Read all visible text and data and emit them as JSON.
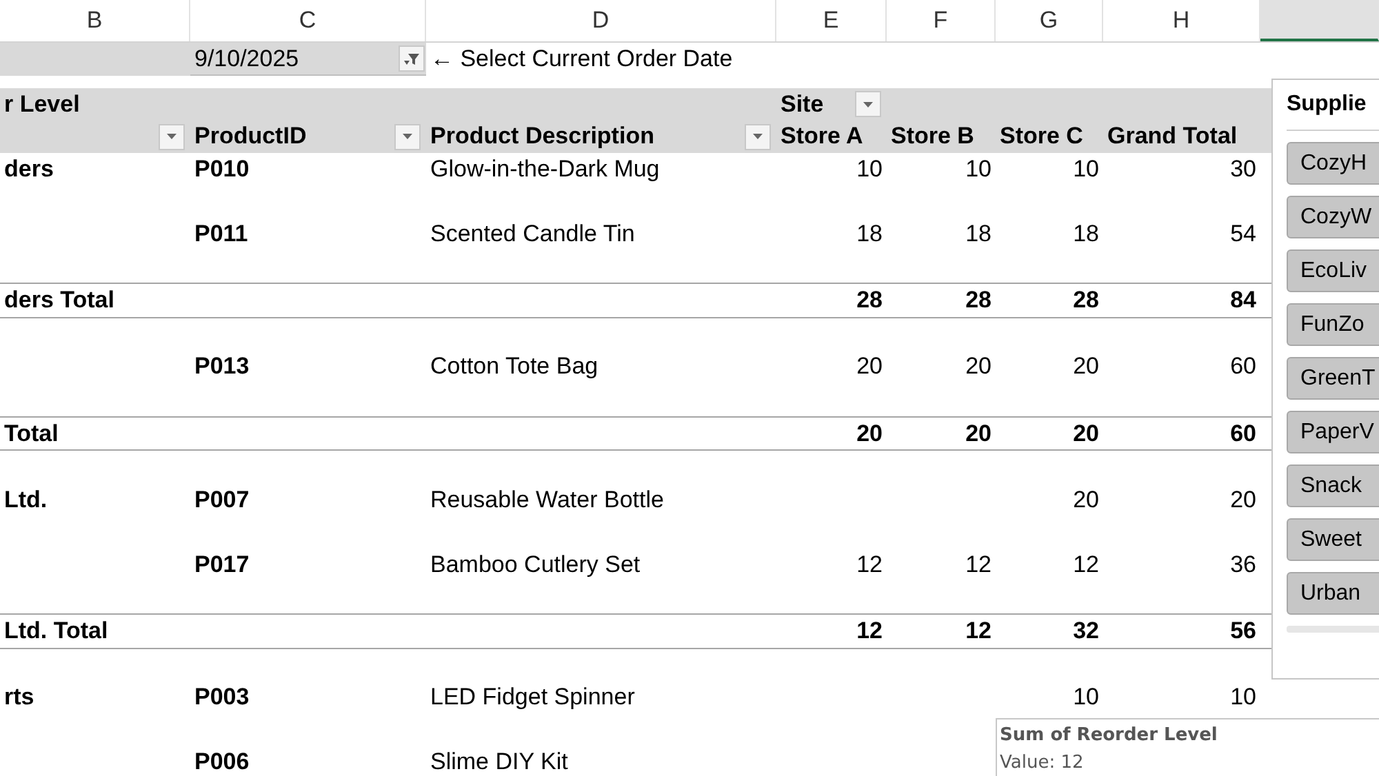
{
  "column_headers": [
    {
      "label": "B",
      "selected": false
    },
    {
      "label": "C",
      "selected": false
    },
    {
      "label": "D",
      "selected": false
    },
    {
      "label": "E",
      "selected": false
    },
    {
      "label": "F",
      "selected": false
    },
    {
      "label": "G",
      "selected": false
    },
    {
      "label": "H",
      "selected": false
    },
    {
      "selected": true
    }
  ],
  "report_filter": {
    "value": "9/10/2025",
    "note": "← Select Current Order Date"
  },
  "pivot": {
    "row_label": "r Level",
    "column_field": "Site",
    "headers": [
      "ProductID",
      "Product Description",
      "Store A",
      "Store B",
      "Store C",
      "Grand Total"
    ],
    "rows": [
      {
        "kind": "item",
        "supplier": "ders",
        "product_id": "P010",
        "description": "Glow-in-the-Dark Mug",
        "values": {
          "store_a": "10",
          "store_b": "10",
          "store_c": "10",
          "grand_total": "30"
        }
      },
      {
        "kind": "item",
        "product_id": "P011",
        "description": "Scented Candle Tin",
        "values": {
          "store_a": "18",
          "store_b": "18",
          "store_c": "18",
          "grand_total": "54"
        }
      },
      {
        "kind": "total",
        "label": "ders Total",
        "values": {
          "store_a": "28",
          "store_b": "28",
          "store_c": "28",
          "grand_total": "84"
        }
      },
      {
        "kind": "item",
        "product_id": "P013",
        "description": "Cotton Tote Bag",
        "values": {
          "store_a": "20",
          "store_b": "20",
          "store_c": "20",
          "grand_total": "60"
        }
      },
      {
        "kind": "total",
        "label": "Total",
        "values": {
          "store_a": "20",
          "store_b": "20",
          "store_c": "20",
          "grand_total": "60"
        }
      },
      {
        "kind": "item",
        "supplier": "Ltd.",
        "product_id": "P007",
        "description": "Reusable Water Bottle",
        "values": {
          "store_c": "20",
          "grand_total": "20"
        }
      },
      {
        "kind": "item",
        "product_id": "P017",
        "description": "Bamboo Cutlery Set",
        "values": {
          "store_a": "12",
          "store_b": "12",
          "store_c": "12",
          "grand_total": "36"
        }
      },
      {
        "kind": "total",
        "label": "Ltd. Total",
        "values": {
          "store_a": "12",
          "store_b": "12",
          "store_c": "32",
          "grand_total": "56"
        }
      },
      {
        "kind": "item",
        "supplier": "rts",
        "product_id": "P003",
        "description": "LED Fidget Spinner",
        "values": {
          "store_c": "10",
          "grand_total": "10"
        }
      },
      {
        "kind": "item",
        "product_id": "P006",
        "description": "Slime DIY Kit"
      }
    ]
  },
  "slicer": {
    "title": "Supplie",
    "items": [
      {
        "label": "CozyH",
        "selected": true
      },
      {
        "label": "CozyW",
        "selected": true
      },
      {
        "label": "EcoLiv",
        "selected": true
      },
      {
        "label": "FunZo",
        "selected": true
      },
      {
        "label": "GreenT",
        "selected": true
      },
      {
        "label": "PaperV",
        "selected": true
      },
      {
        "label": "Snack",
        "selected": true
      },
      {
        "label": "Sweet",
        "selected": true
      },
      {
        "label": "Urban",
        "selected": true
      }
    ]
  },
  "tooltip": {
    "title": "Sum of Reorder Level",
    "value": "Value: 12"
  }
}
